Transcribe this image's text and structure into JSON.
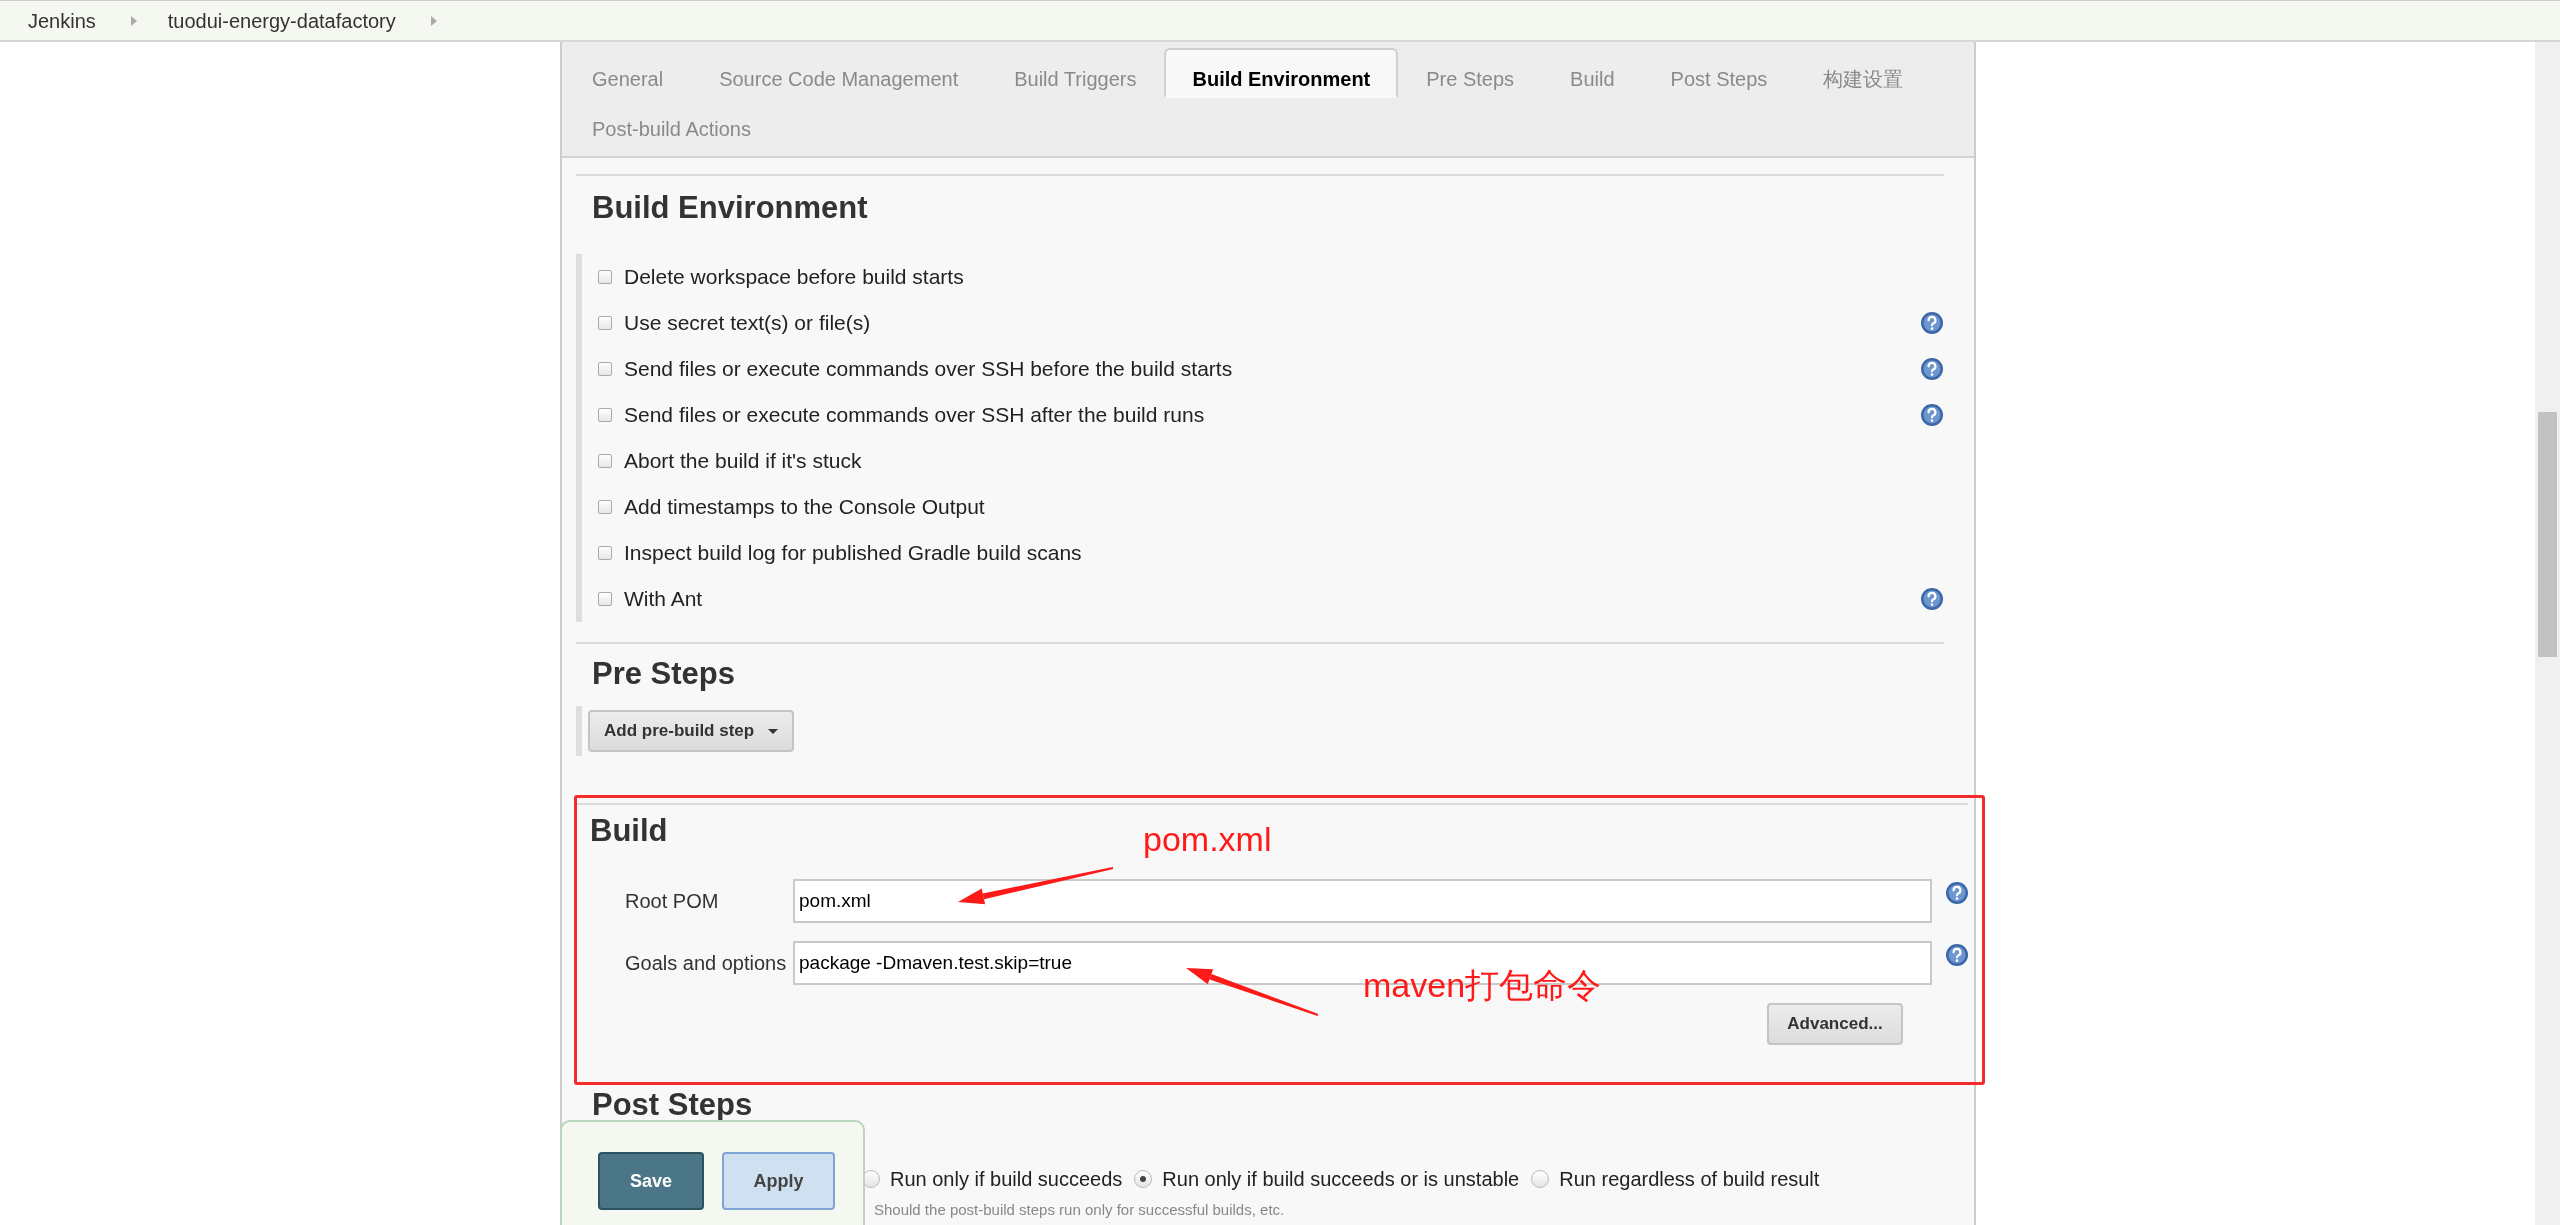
{
  "breadcrumbs": [
    "Jenkins",
    "tuodui-energy-datafactory"
  ],
  "tabs": [
    {
      "label": "General",
      "selected": false
    },
    {
      "label": "Source Code Management",
      "selected": false
    },
    {
      "label": "Build Triggers",
      "selected": false
    },
    {
      "label": "Build Environment",
      "selected": true
    },
    {
      "label": "Pre Steps",
      "selected": false
    },
    {
      "label": "Build",
      "selected": false
    },
    {
      "label": "Post Steps",
      "selected": false
    },
    {
      "label": "构建设置",
      "selected": false
    },
    {
      "label": "Post-build Actions",
      "selected": false
    }
  ],
  "build_environment": {
    "title": "Build Environment",
    "options": [
      {
        "label": "Delete workspace before build starts",
        "checked": false,
        "help": false
      },
      {
        "label": "Use secret text(s) or file(s)",
        "checked": false,
        "help": true
      },
      {
        "label": "Send files or execute commands over SSH before the build starts",
        "checked": false,
        "help": true
      },
      {
        "label": "Send files or execute commands over SSH after the build runs",
        "checked": false,
        "help": true
      },
      {
        "label": "Abort the build if it's stuck",
        "checked": false,
        "help": false
      },
      {
        "label": "Add timestamps to the Console Output",
        "checked": false,
        "help": false
      },
      {
        "label": "Inspect build log for published Gradle build scans",
        "checked": false,
        "help": false
      },
      {
        "label": "With Ant",
        "checked": false,
        "help": true
      }
    ]
  },
  "pre_steps": {
    "title": "Pre Steps",
    "button": "Add pre-build step"
  },
  "build": {
    "title": "Build",
    "fields": [
      {
        "label": "Root POM",
        "value": "pom.xml",
        "help": true
      },
      {
        "label": "Goals and options",
        "value": "package -Dmaven.test.skip=true",
        "help": true
      }
    ],
    "advanced_button": "Advanced..."
  },
  "annotations": [
    {
      "text": "pom.xml"
    },
    {
      "text": "maven打包命令"
    }
  ],
  "post_steps": {
    "title": "Post Steps",
    "options": [
      {
        "label": "Run only if build succeeds",
        "selected": false
      },
      {
        "label": "Run only if build succeeds or is unstable",
        "selected": true
      },
      {
        "label": "Run regardless of build result",
        "selected": false
      }
    ],
    "hint": "Should the post-build steps run only for successful builds, etc."
  },
  "save_bar": {
    "buttons": [
      {
        "label": "Save",
        "kind": "primary"
      },
      {
        "label": "Apply",
        "kind": "secondary"
      }
    ]
  }
}
